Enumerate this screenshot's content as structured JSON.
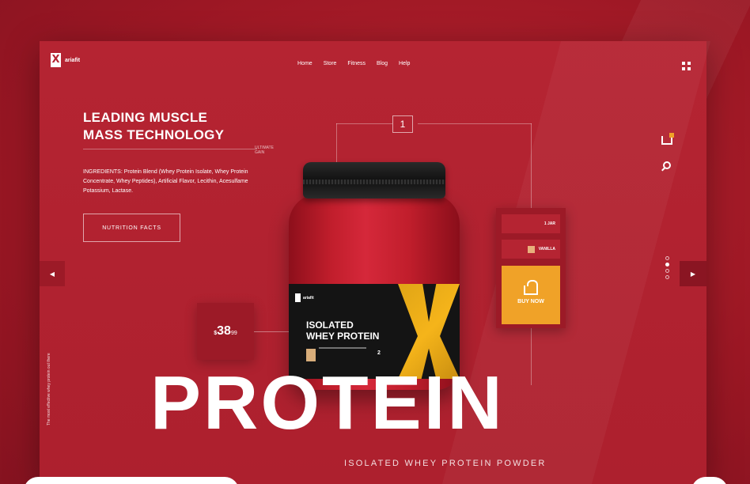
{
  "header": {
    "logo_text": "ariafit",
    "logo_mark": "X",
    "nav": [
      "Home",
      "Store",
      "Fitness",
      "Blog",
      "Help"
    ]
  },
  "hero": {
    "headline_line1": "LEADING MUSCLE",
    "headline_line2": "MASS TECHNOLOGY",
    "gain_label_small": "ULTIMATE",
    "gain_label": "GAIN",
    "ingredients": "INGREDIENTS: Protein Blend (Whey Protein Isolate, Whey Protein Concentrate, Whey Peptides), Artificial Flavor, Lecithin, Acesulfame Potassium, Lactase.",
    "nutrition_button": "NUTRITION FACTS"
  },
  "price": {
    "currency": "$",
    "dollars": "38",
    "cents": "99"
  },
  "step_number": "1",
  "product": {
    "label_brand": "ariafit",
    "label_title_line1": "ISOLATED",
    "label_title_line2": "WHEY PROTEIN",
    "label_weight": "2"
  },
  "order": {
    "size_option": "1 JAR",
    "flavor_option": "VANILLA",
    "buy_button": "BUY NOW"
  },
  "big_title": "PROTEIN",
  "subtitle": "ISOLATED WHEY PROTEIN POWDER",
  "side_text": "The most effective whey protein out there",
  "carousel": {
    "dots": 4,
    "active_index": 1
  },
  "colors": {
    "primary_red": "#b52432",
    "dark_red": "#9c1a27",
    "accent_orange": "#f0a228",
    "label_gold": "#f5b41a"
  },
  "icons": [
    "cart-icon",
    "search-icon",
    "menu-grid-icon",
    "arrow-left-icon",
    "arrow-right-icon",
    "basket-icon"
  ]
}
